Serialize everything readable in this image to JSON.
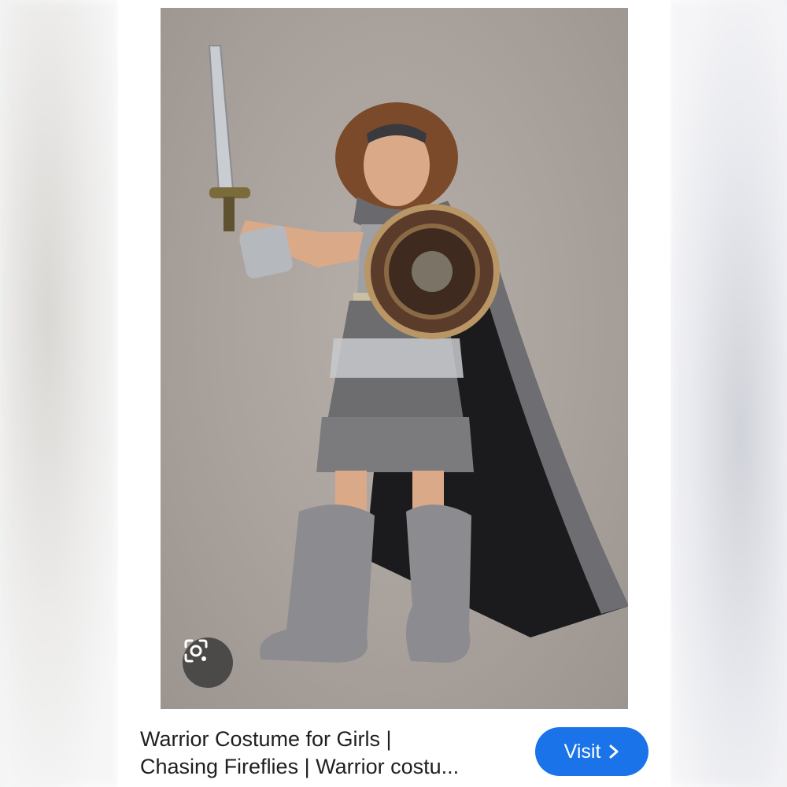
{
  "result": {
    "title_line1": "Warrior Costume for Girls |",
    "title_line2": "Chasing Fireflies | Warrior costu...",
    "visit_label": "Visit",
    "visit_icon": "chevron-right-icon",
    "lens_icon": "google-lens-icon"
  },
  "colors": {
    "visit_button": "#1a73e8",
    "photo_background": "#aca49e"
  }
}
